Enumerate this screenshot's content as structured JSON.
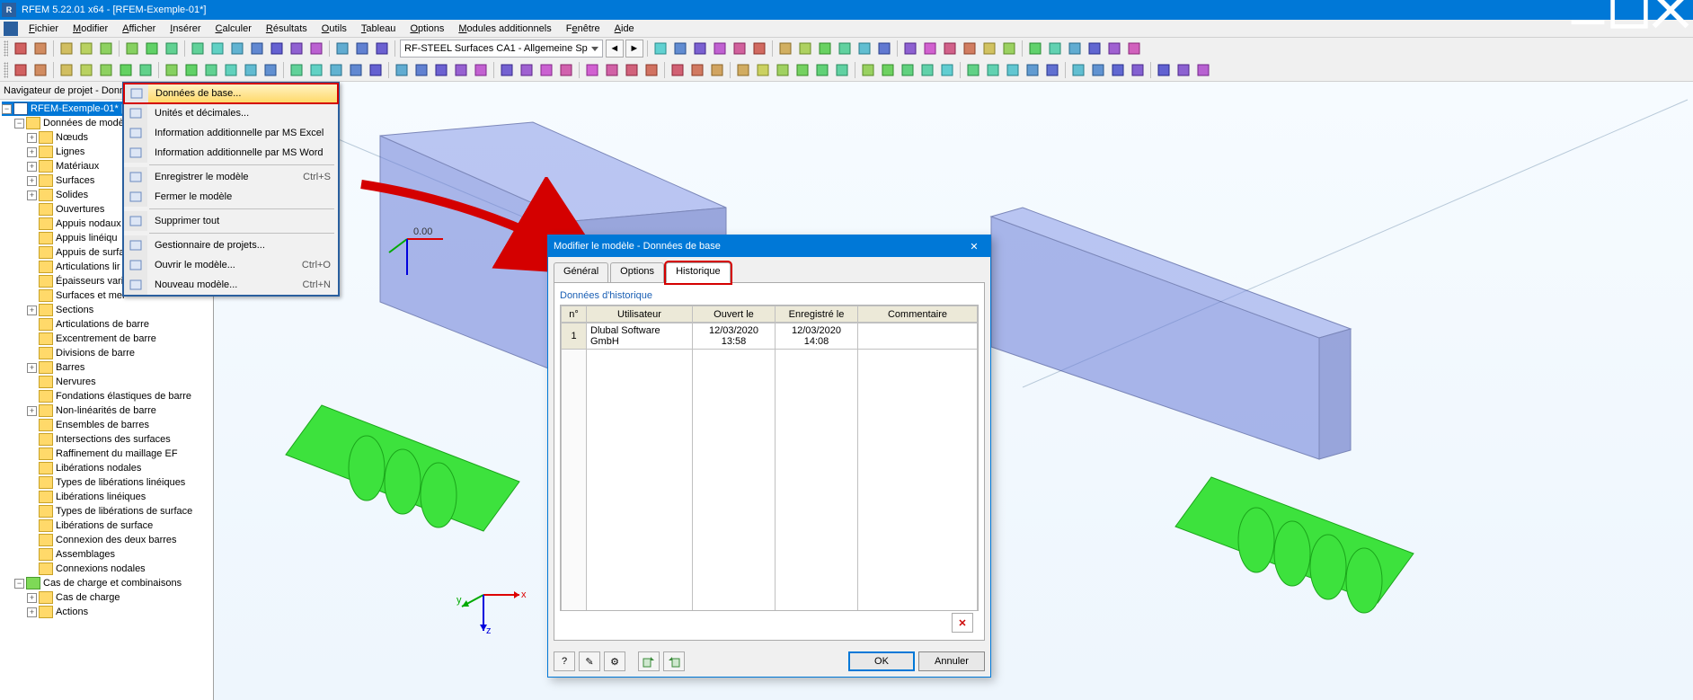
{
  "window": {
    "title": "RFEM 5.22.01 x64 - [RFEM-Exemple-01*]",
    "app_icon_text": "R"
  },
  "menu": {
    "items": [
      "Fichier",
      "Modifier",
      "Afficher",
      "Insérer",
      "Calculer",
      "Résultats",
      "Outils",
      "Tableau",
      "Options",
      "Modules additionnels",
      "Fenêtre",
      "Aide"
    ],
    "accel_positions": [
      0,
      0,
      0,
      0,
      0,
      0,
      0,
      0,
      0,
      0,
      1,
      0
    ]
  },
  "toolbar": {
    "combo_value": "RF-STEEL Surfaces CA1 - Allgemeine Sp"
  },
  "navigator": {
    "title": "Navigateur de projet - Données",
    "root": "RFEM-Exemple-01* [E...",
    "model_data": "Données de modè",
    "nodes": [
      "Nœuds",
      "Lignes",
      "Matériaux",
      "Surfaces",
      "Solides",
      "Ouvertures",
      "Appuis nodaux",
      "Appuis linéiqu",
      "Appuis de surfa",
      "Articulations lir",
      "Épaisseurs varia",
      "Surfaces et mer"
    ],
    "nodes2": [
      "Sections",
      "Articulations de barre",
      "Excentrement de barre",
      "Divisions de barre",
      "Barres",
      "Nervures",
      "Fondations élastiques de barre",
      "Non-linéarités de barre",
      "Ensembles de barres",
      "Intersections des surfaces",
      "Raffinement du maillage EF",
      "Libérations nodales",
      "Types de libérations linéiques",
      "Libérations linéiques",
      "Types de libérations de surface",
      "Libérations de surface",
      "Connexion des deux barres",
      "Assemblages",
      "Connexions nodales"
    ],
    "load_root": "Cas de charge et combinaisons",
    "load_children": [
      "Cas de charge",
      "Actions"
    ]
  },
  "context_menu": {
    "items": [
      {
        "label": "Données de base...",
        "hl": true,
        "boxed": true
      },
      {
        "label": "Unités et décimales..."
      },
      {
        "label": "Information additionnelle par MS Excel"
      },
      {
        "label": "Information additionnelle par MS Word"
      },
      {
        "sep": true
      },
      {
        "label": "Enregistrer le modèle",
        "accel": "Ctrl+S"
      },
      {
        "label": "Fermer le modèle"
      },
      {
        "sep": true
      },
      {
        "label": "Supprimer tout"
      },
      {
        "sep": true
      },
      {
        "label": "Gestionnaire de projets..."
      },
      {
        "label": "Ouvrir le modèle...",
        "accel": "Ctrl+O"
      },
      {
        "label": "Nouveau modèle...",
        "accel": "Ctrl+N"
      }
    ]
  },
  "dialog": {
    "title": "Modifier le modèle - Données de base",
    "tabs": [
      "Général",
      "Options",
      "Historique"
    ],
    "active_tab": 2,
    "group": "Données d'historique",
    "columns": [
      "n°",
      "Utilisateur",
      "Ouvert le",
      "Enregistré le",
      "Commentaire"
    ],
    "rows": [
      {
        "n": "1",
        "user": "Dlubal Software GmbH",
        "opened": "12/03/2020 13:58",
        "saved": "12/03/2020 14:08",
        "comment": ""
      }
    ],
    "delete_tooltip": "Supprimer la ligne",
    "btn_ok": "OK",
    "btn_cancel": "Annuler"
  },
  "axes": {
    "x": "x",
    "y": "y",
    "z": "z",
    "origin": "0.00"
  }
}
